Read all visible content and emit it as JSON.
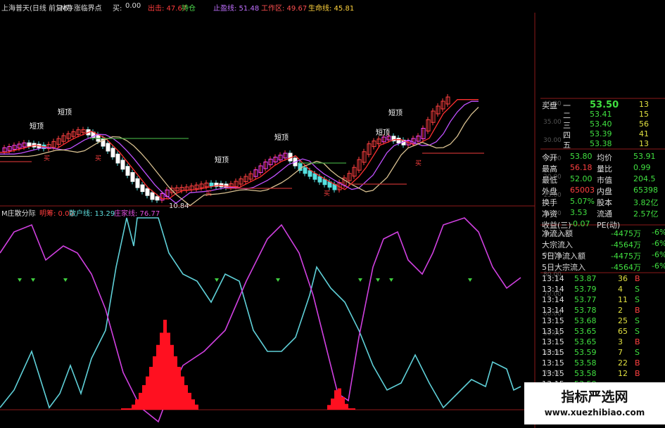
{
  "topbar": {
    "stock": "上海普天(日线 前复权)",
    "indicator": "M牛涨临界点",
    "buy_label": "买:",
    "buy_value": "0.00",
    "sell": "出击: 47.67",
    "hold": "持仓",
    "stop": "止盈线: 51.48",
    "work": "工作区: 49.67",
    "life": "生命线: 45.81"
  },
  "indicator2": {
    "name": "M庄散分际",
    "a": "明筹: 0.00",
    "b": "散户线: 13.29",
    "c": "庄家线: 76.77"
  },
  "annotations": {
    "short_top": "短顶",
    "buy_mark": "买",
    "low": "10.84"
  },
  "price_axis": [
    "40.00",
    "35.00",
    "30.00",
    "25.00",
    "20.00",
    "15.00",
    "10.00"
  ],
  "osc_axis": [
    "100.00",
    "90.00",
    "80.00",
    "70.00",
    "60.00",
    "50.00",
    "40.00",
    "30.00",
    "20.00"
  ],
  "quote": {
    "orderbook": [
      {
        "label": "买盘",
        "level": "一",
        "price": "53.50",
        "vol": "13"
      },
      {
        "label": "",
        "level": "二",
        "price": "53.41",
        "vol": "15"
      },
      {
        "label": "",
        "level": "三",
        "price": "53.40",
        "vol": "56"
      },
      {
        "label": "",
        "level": "四",
        "price": "53.39",
        "vol": "41"
      },
      {
        "label": "",
        "level": "五",
        "price": "53.38",
        "vol": "13"
      }
    ],
    "stats": [
      {
        "k1": "今开",
        "v1": "53.80",
        "k2": "均价",
        "v2": "53.91"
      },
      {
        "k1": "最高",
        "v1": "56.18",
        "k2": "量比",
        "v2": "0.99"
      },
      {
        "k1": "最低",
        "v1": "52.00",
        "k2": "市值",
        "v2": "204.5"
      },
      {
        "k1": "外盘",
        "v1": "65003",
        "k2": "内盘",
        "v2": "65398"
      },
      {
        "k1": "换手",
        "v1": "5.07%",
        "k2": "股本",
        "v2": "3.82亿"
      },
      {
        "k1": "净资",
        "v1": "3.53",
        "k2": "流通",
        "v2": "2.57亿"
      },
      {
        "k1": "收益(三)",
        "v1": "-0.07",
        "k2": "PE(动)",
        "v2": ""
      }
    ],
    "flows": [
      {
        "k": "净流入额",
        "v": "-4475万",
        "p": "-6%"
      },
      {
        "k": "大宗流入",
        "v": "-4564万",
        "p": "-6%"
      },
      {
        "k": "5日净流入额",
        "v": "-4475万",
        "p": "-6%"
      },
      {
        "k": "5日大宗流入",
        "v": "-4564万",
        "p": "-6%"
      }
    ],
    "ticks": [
      {
        "t": "13:14",
        "p": "53.87",
        "v": "36",
        "s": "B"
      },
      {
        "t": "13:14",
        "p": "53.79",
        "v": "4",
        "s": "S"
      },
      {
        "t": "13:14",
        "p": "53.77",
        "v": "11",
        "s": "S"
      },
      {
        "t": "13:14",
        "p": "53.78",
        "v": "2",
        "s": "B"
      },
      {
        "t": "13:15",
        "p": "53.68",
        "v": "25",
        "s": "S"
      },
      {
        "t": "13:15",
        "p": "53.65",
        "v": "65",
        "s": "S"
      },
      {
        "t": "13:15",
        "p": "53.65",
        "v": "3",
        "s": "B"
      },
      {
        "t": "13:15",
        "p": "53.59",
        "v": "7",
        "s": "S"
      },
      {
        "t": "13:15",
        "p": "53.58",
        "v": "22",
        "s": "B"
      },
      {
        "t": "13:15",
        "p": "53.58",
        "v": "12",
        "s": "B"
      },
      {
        "t": "13:15",
        "p": "53.58",
        "v": "",
        "s": ""
      }
    ]
  },
  "watermark": {
    "cn": "指标严选网",
    "url": "www.xuezhibiao.com"
  }
}
